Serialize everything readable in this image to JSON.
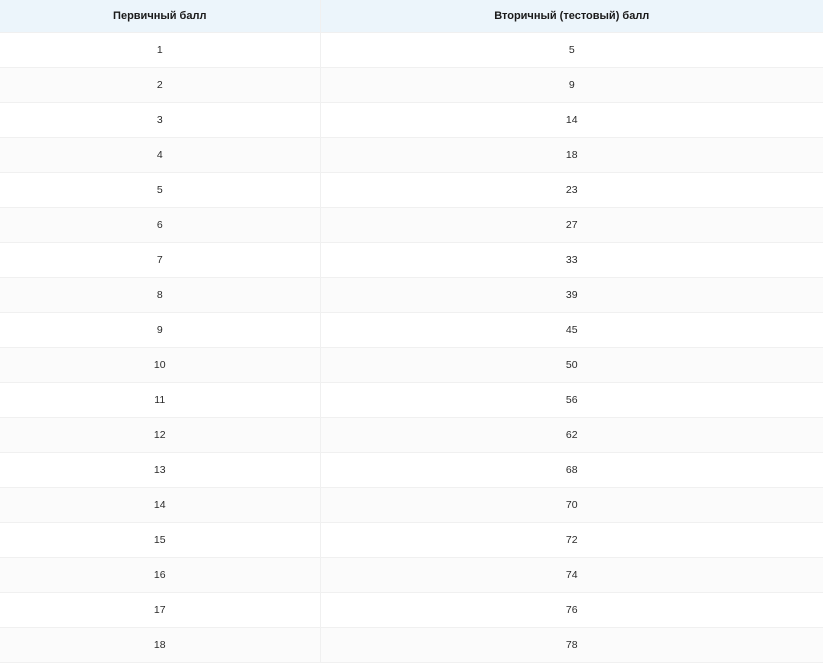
{
  "table": {
    "headers": {
      "primary": "Первичный балл",
      "secondary": "Вторичный (тестовый) балл"
    },
    "rows": [
      {
        "primary": "1",
        "secondary": "5"
      },
      {
        "primary": "2",
        "secondary": "9"
      },
      {
        "primary": "3",
        "secondary": "14"
      },
      {
        "primary": "4",
        "secondary": "18"
      },
      {
        "primary": "5",
        "secondary": "23"
      },
      {
        "primary": "6",
        "secondary": "27"
      },
      {
        "primary": "7",
        "secondary": "33"
      },
      {
        "primary": "8",
        "secondary": "39"
      },
      {
        "primary": "9",
        "secondary": "45"
      },
      {
        "primary": "10",
        "secondary": "50"
      },
      {
        "primary": "11",
        "secondary": "56"
      },
      {
        "primary": "12",
        "secondary": "62"
      },
      {
        "primary": "13",
        "secondary": "68"
      },
      {
        "primary": "14",
        "secondary": "70"
      },
      {
        "primary": "15",
        "secondary": "72"
      },
      {
        "primary": "16",
        "secondary": "74"
      },
      {
        "primary": "17",
        "secondary": "76"
      },
      {
        "primary": "18",
        "secondary": "78"
      }
    ]
  }
}
